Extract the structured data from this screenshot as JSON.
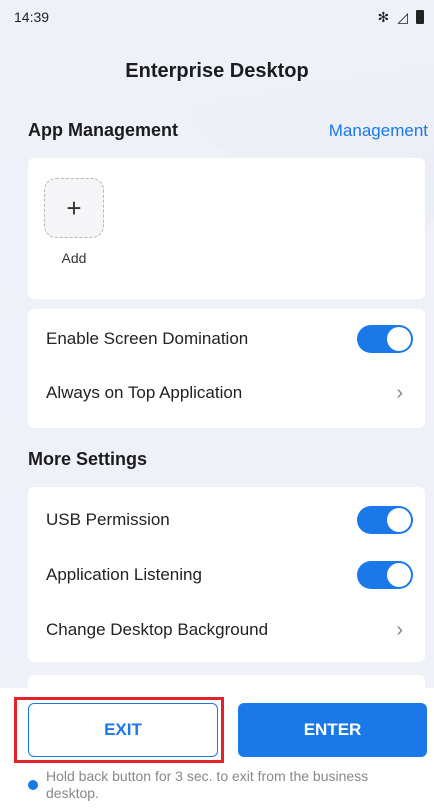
{
  "status_bar": {
    "time": "14:39",
    "bluetooth": "✻",
    "signal": "◿"
  },
  "header": {
    "title": "Enterprise Desktop"
  },
  "app_management": {
    "heading": "App Management",
    "link": "Management",
    "add_symbol": "+",
    "add_label": "Add"
  },
  "screen_section": {
    "rows": [
      {
        "label": "Enable Screen Domination",
        "control": "toggle",
        "on": true
      },
      {
        "label": "Always on Top Application",
        "control": "chevron"
      }
    ]
  },
  "more_settings": {
    "heading": "More Settings",
    "rows": [
      {
        "label": "USB Permission",
        "control": "toggle",
        "on": true
      },
      {
        "label": "Application Listening",
        "control": "toggle",
        "on": true
      },
      {
        "label": "Change Desktop Background",
        "control": "chevron"
      }
    ]
  },
  "footer": {
    "exit_label": "EXIT",
    "enter_label": "ENTER",
    "hint": "Hold back button for 3 sec. to exit from the business desktop."
  },
  "colors": {
    "accent": "#1a78e8",
    "highlight": "#e0242b"
  },
  "icons": {
    "chevron": "chevron-right-icon",
    "info": "info-icon",
    "plus": "plus-icon"
  }
}
